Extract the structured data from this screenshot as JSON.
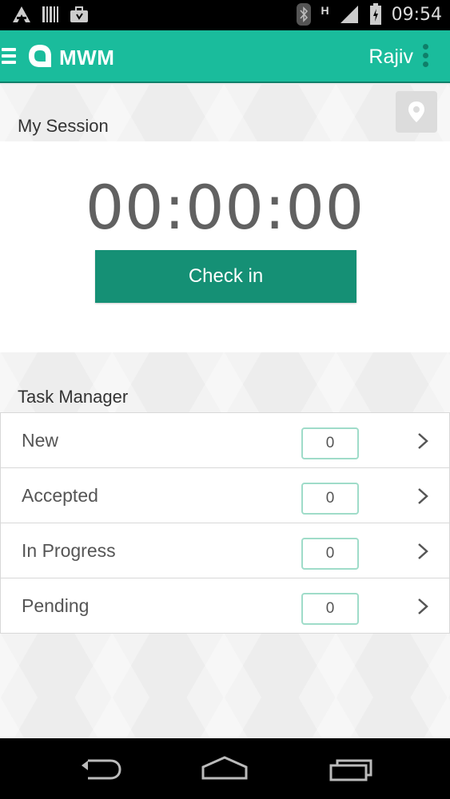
{
  "status_bar": {
    "time": "09:54",
    "network_label": "H",
    "icons": [
      "app-icon",
      "barcode-icon",
      "briefcase-icon",
      "bluetooth-icon",
      "signal-icon",
      "battery-icon"
    ]
  },
  "app_bar": {
    "title": "MWM",
    "user": "Rajiv",
    "icons": [
      "menu-icon",
      "logo-icon",
      "more-vert-icon"
    ],
    "color": "#1abc9c"
  },
  "session": {
    "title": "My Session",
    "timer": "00:00:00",
    "button_label": "Check in",
    "button_color": "#159075",
    "location_icon": "location-pin-icon"
  },
  "task_manager": {
    "title": "Task Manager",
    "items": [
      {
        "label": "New",
        "count": "0"
      },
      {
        "label": "Accepted",
        "count": "0"
      },
      {
        "label": "In Progress",
        "count": "0"
      },
      {
        "label": "Pending",
        "count": "0"
      }
    ]
  },
  "nav_bar": {
    "icons": [
      "back-icon",
      "home-icon",
      "recents-icon"
    ]
  }
}
